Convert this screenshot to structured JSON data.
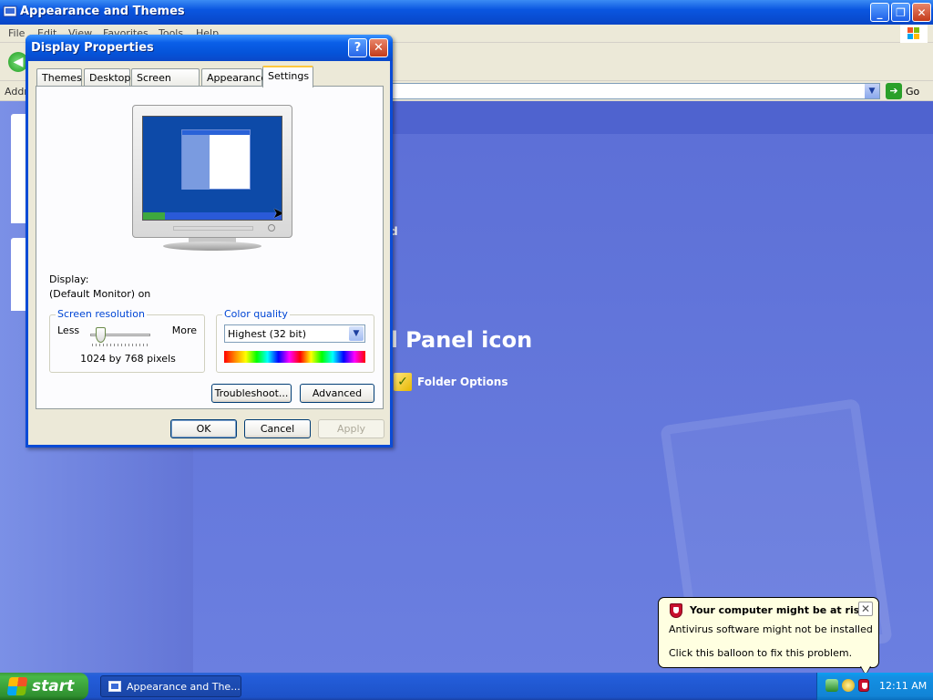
{
  "explorer": {
    "title": "Appearance and Themes",
    "menu": [
      "File",
      "Edit",
      "View",
      "Favorites",
      "Tools",
      "Help"
    ],
    "address_label": "Address",
    "go_label": "Go",
    "heading_fragment": "ol Panel icon",
    "left_fragment": "d",
    "folder_options": "Folder Options"
  },
  "dialog": {
    "title": "Display Properties",
    "help_glyph": "?",
    "close_glyph": "✕",
    "tabs": [
      "Themes",
      "Desktop",
      "Screen Saver",
      "Appearance",
      "Settings"
    ],
    "active_tab": "Settings",
    "display_label": "Display:",
    "display_value": "(Default Monitor) on",
    "screen_resolution": {
      "legend": "Screen resolution",
      "less": "Less",
      "more": "More",
      "value": "1024 by 768 pixels",
      "slider_position": 0.1
    },
    "color_quality": {
      "legend": "Color quality",
      "selected": "Highest (32 bit)"
    },
    "buttons": {
      "troubleshoot": "Troubleshoot...",
      "advanced": "Advanced",
      "ok": "OK",
      "cancel": "Cancel",
      "apply": "Apply"
    }
  },
  "balloon": {
    "title": "Your computer might be at risk",
    "line1": "Antivirus software might not be installed",
    "line2": "Click this balloon to fix this problem.",
    "close_glyph": "✕"
  },
  "taskbar": {
    "start_label": "start",
    "task_item": "Appearance and The...",
    "clock": "12:11 AM"
  },
  "colors": {
    "titlebar_blue": "#0a5fe8",
    "start_green": "#3c9c3c",
    "balloon_bg": "#ffffe1",
    "groupbox_legend": "#0046d5"
  }
}
